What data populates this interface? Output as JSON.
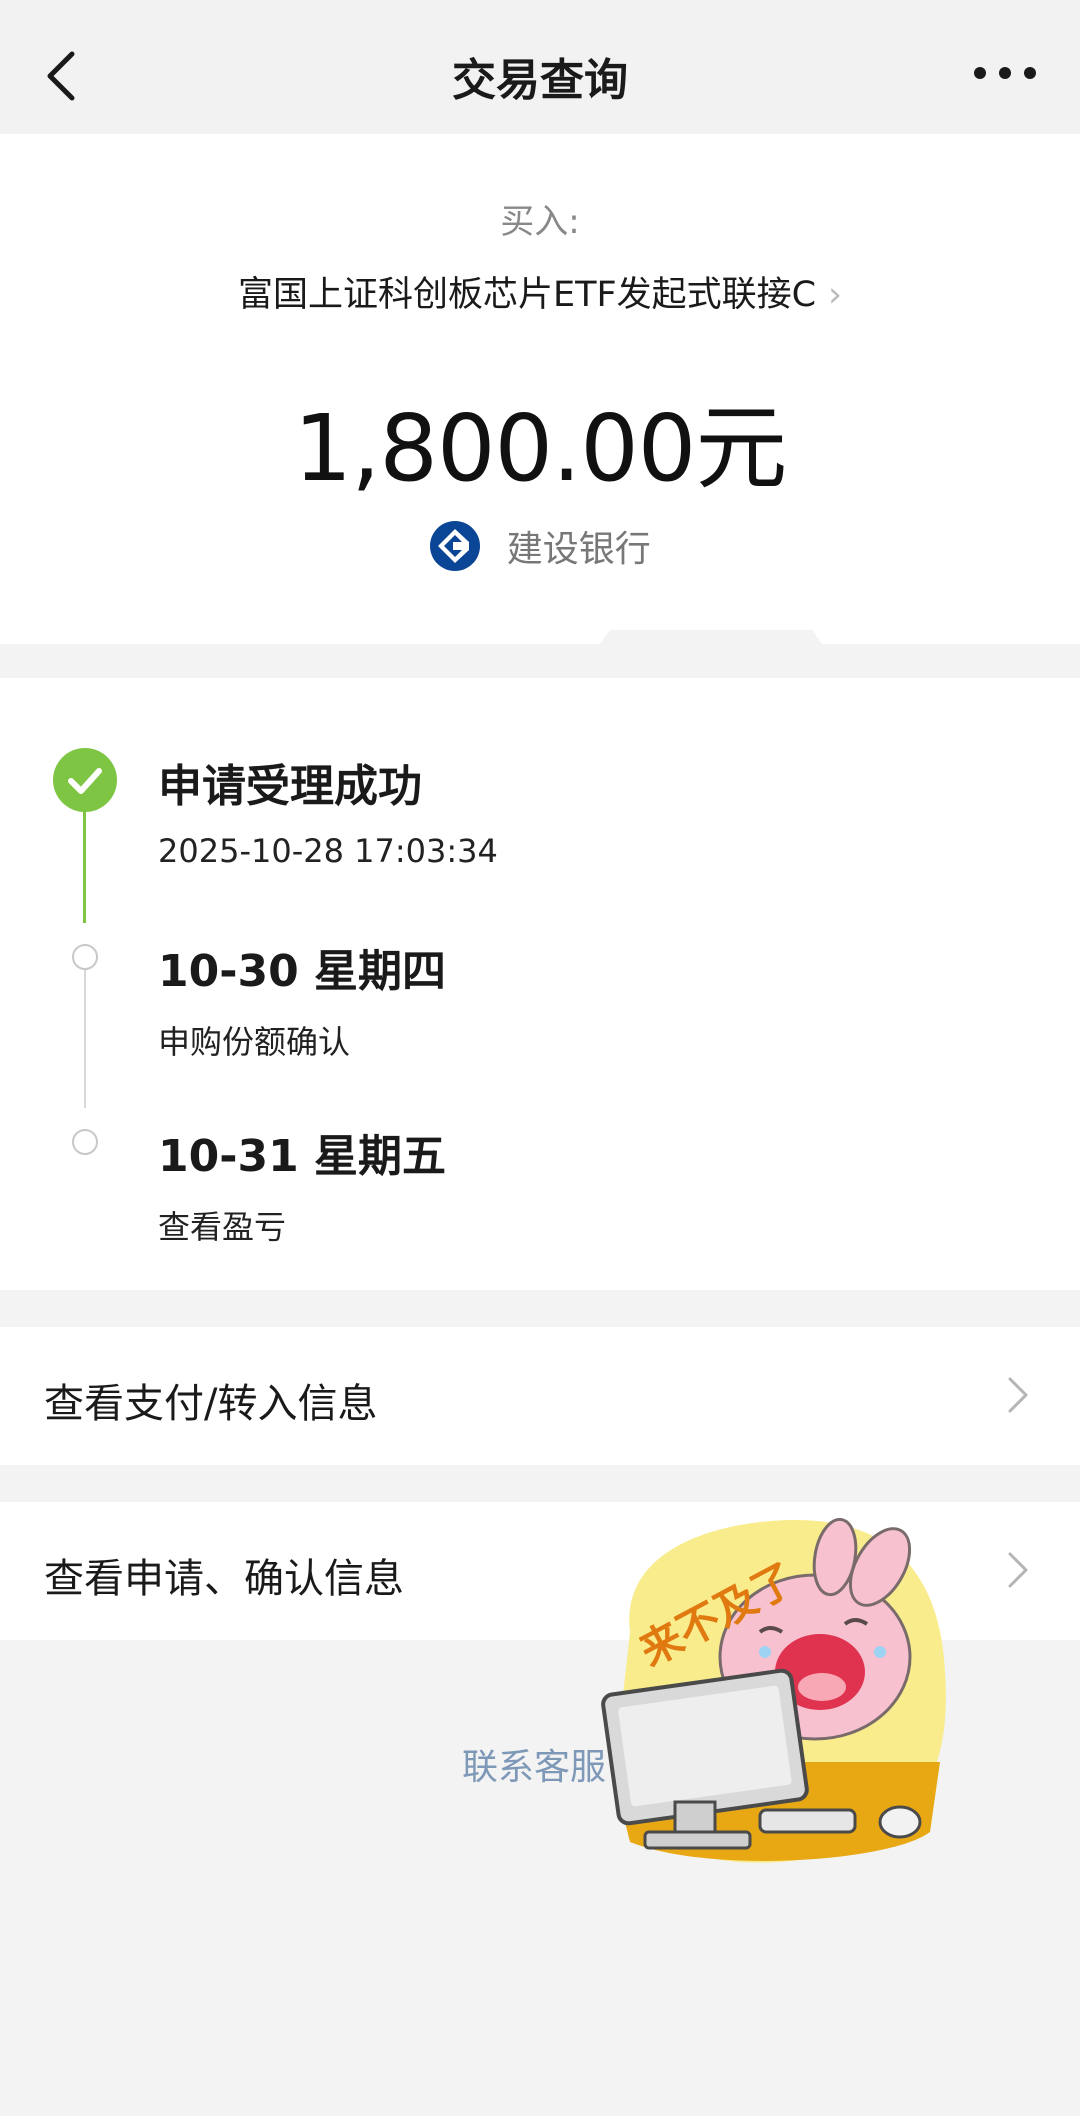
{
  "navbar": {
    "title": "交易查询",
    "back_icon": "back-chevron-icon",
    "more_icon": "more-dots-icon"
  },
  "summary": {
    "buy_label": "买入:",
    "fund_name": "富国上证科创板芯片ETF发起式联接C",
    "fund_chevron": "›",
    "amount": "1,800.00元",
    "bank_name": "建设银行",
    "bank_color": "#0a4596"
  },
  "timeline": {
    "accent": "#7dc542",
    "steps": [
      {
        "title": "申请受理成功",
        "subtitle": "2025-10-28 17:03:34"
      },
      {
        "title": "10-30 星期四",
        "subtitle": "申购份额确认"
      },
      {
        "title": "10-31 星期五",
        "subtitle": "查看盈亏"
      }
    ]
  },
  "links": [
    {
      "label": "查看支付/转入信息"
    },
    {
      "label": "查看申请、确认信息"
    }
  ],
  "contact": {
    "label": "联系客服"
  },
  "sticker": {
    "text": "来不及了"
  }
}
